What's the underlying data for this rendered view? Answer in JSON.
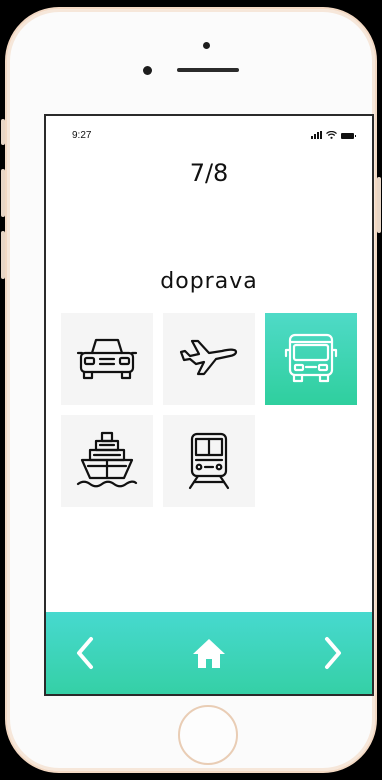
{
  "status_bar": {
    "time": "9:27",
    "icons": [
      "signal-icon",
      "wifi-icon",
      "battery-icon"
    ]
  },
  "quiz": {
    "progress": "7/8",
    "category": "doprava"
  },
  "tiles": [
    {
      "icon": "car-icon",
      "selected": false
    },
    {
      "icon": "airplane-icon",
      "selected": false
    },
    {
      "icon": "bus-icon",
      "selected": true
    },
    {
      "icon": "ship-icon",
      "selected": false
    },
    {
      "icon": "train-icon",
      "selected": false
    }
  ],
  "nav": {
    "icons": [
      "chevron-left-icon",
      "home-icon",
      "chevron-right-icon"
    ]
  },
  "colors": {
    "accent_top": "#47d9cf",
    "accent_bottom": "#35d0a6",
    "tile_bg": "#f5f5f5"
  }
}
